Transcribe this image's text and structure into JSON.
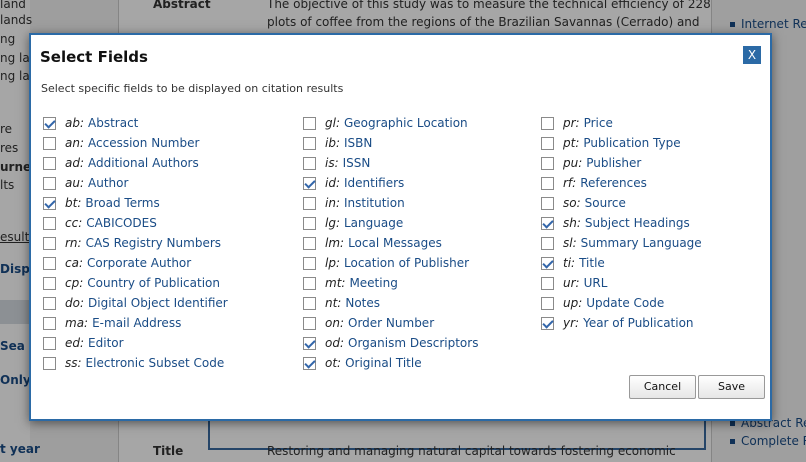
{
  "background": {
    "left_fragments": [
      "land",
      "lands",
      "ng",
      "ng lar",
      "ng lar",
      "re",
      "res",
      "urne",
      "lts",
      "esults",
      "Disp",
      "Sea",
      "Only",
      "t year"
    ],
    "abstract_label": "Abstract",
    "abstract_text_1": "The objective of this study was to measure the technical efficiency of 228",
    "abstract_text_2": "plots of coffee from the regions of the Brazilian Savannas (Cerrado) and",
    "title_label": "Title",
    "title_text": "Restoring and managing natural capital towards fostering economic",
    "right_links": [
      "Internet Re",
      "Abstract Re",
      "Complete R"
    ]
  },
  "dialog": {
    "title": "Select Fields",
    "close_label": "X",
    "subtitle": "Select specific fields to be displayed on citation results",
    "columns": [
      [
        {
          "code": "ab:",
          "label": "Abstract",
          "checked": true
        },
        {
          "code": "an:",
          "label": "Accession Number",
          "checked": false
        },
        {
          "code": "ad:",
          "label": "Additional Authors",
          "checked": false
        },
        {
          "code": "au:",
          "label": "Author",
          "checked": false
        },
        {
          "code": "bt:",
          "label": "Broad Terms",
          "checked": true
        },
        {
          "code": "cc:",
          "label": "CABICODES",
          "checked": false
        },
        {
          "code": "rn:",
          "label": "CAS Registry Numbers",
          "checked": false
        },
        {
          "code": "ca:",
          "label": "Corporate Author",
          "checked": false
        },
        {
          "code": "cp:",
          "label": "Country of Publication",
          "checked": false
        },
        {
          "code": "do:",
          "label": "Digital Object Identifier",
          "checked": false
        },
        {
          "code": "ma:",
          "label": "E-mail Address",
          "checked": false
        },
        {
          "code": "ed:",
          "label": "Editor",
          "checked": false
        },
        {
          "code": "ss:",
          "label": "Electronic Subset Code",
          "checked": false
        }
      ],
      [
        {
          "code": "gl:",
          "label": "Geographic Location",
          "checked": false
        },
        {
          "code": "ib:",
          "label": "ISBN",
          "checked": false
        },
        {
          "code": "is:",
          "label": "ISSN",
          "checked": false
        },
        {
          "code": "id:",
          "label": "Identifiers",
          "checked": true
        },
        {
          "code": "in:",
          "label": "Institution",
          "checked": false
        },
        {
          "code": "lg:",
          "label": "Language",
          "checked": false
        },
        {
          "code": "lm:",
          "label": "Local Messages",
          "checked": false
        },
        {
          "code": "lp:",
          "label": "Location of Publisher",
          "checked": false
        },
        {
          "code": "mt:",
          "label": "Meeting",
          "checked": false
        },
        {
          "code": "nt:",
          "label": "Notes",
          "checked": false
        },
        {
          "code": "on:",
          "label": "Order Number",
          "checked": false
        },
        {
          "code": "od:",
          "label": "Organism Descriptors",
          "checked": true
        },
        {
          "code": "ot:",
          "label": "Original Title",
          "checked": true
        }
      ],
      [
        {
          "code": "pr:",
          "label": "Price",
          "checked": false
        },
        {
          "code": "pt:",
          "label": "Publication Type",
          "checked": false
        },
        {
          "code": "pu:",
          "label": "Publisher",
          "checked": false
        },
        {
          "code": "rf:",
          "label": "References",
          "checked": false
        },
        {
          "code": "so:",
          "label": "Source",
          "checked": false
        },
        {
          "code": "sh:",
          "label": "Subject Headings",
          "checked": true
        },
        {
          "code": "sl:",
          "label": "Summary Language",
          "checked": false
        },
        {
          "code": "ti:",
          "label": "Title",
          "checked": true
        },
        {
          "code": "ur:",
          "label": "URL",
          "checked": false
        },
        {
          "code": "up:",
          "label": "Update Code",
          "checked": false
        },
        {
          "code": "yr:",
          "label": "Year of Publication",
          "checked": true
        }
      ]
    ],
    "cancel_label": "Cancel",
    "save_label": "Save"
  }
}
